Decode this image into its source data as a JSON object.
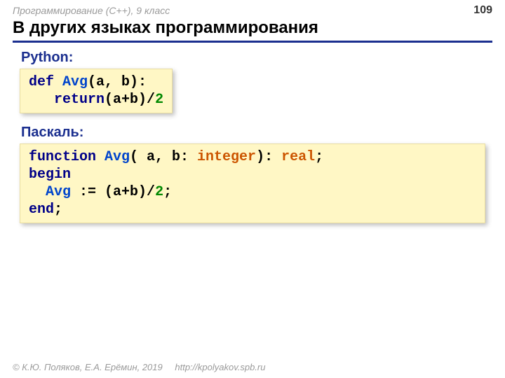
{
  "header": {
    "course": "Программирование (C++), 9 класс",
    "page": "109"
  },
  "title": "В других языках программирования",
  "sections": {
    "python": {
      "label": "Python:",
      "code": {
        "def": "def",
        "fn": " Avg",
        "sig": "(a, b):",
        "ret": "   return",
        "expr": "(a+b)",
        "slash": "/",
        "two": "2"
      }
    },
    "pascal": {
      "label": "Паскаль:",
      "code": {
        "function": "function",
        "fn": " Avg",
        "open": "( a, b: ",
        "integer": "integer",
        "close": "): ",
        "real": "real",
        "semi1": ";",
        "begin": "begin",
        "assignL": "  Avg",
        "assignOp": " := ",
        "expr": "(a+b)",
        "slash": "/",
        "two": "2",
        "semi2": ";",
        "end": "end",
        "semi3": ";"
      }
    }
  },
  "footer": {
    "copyright": "© К.Ю. Поляков, Е.А. Ерёмин, 2019",
    "url": "http://kpolyakov.spb.ru"
  }
}
